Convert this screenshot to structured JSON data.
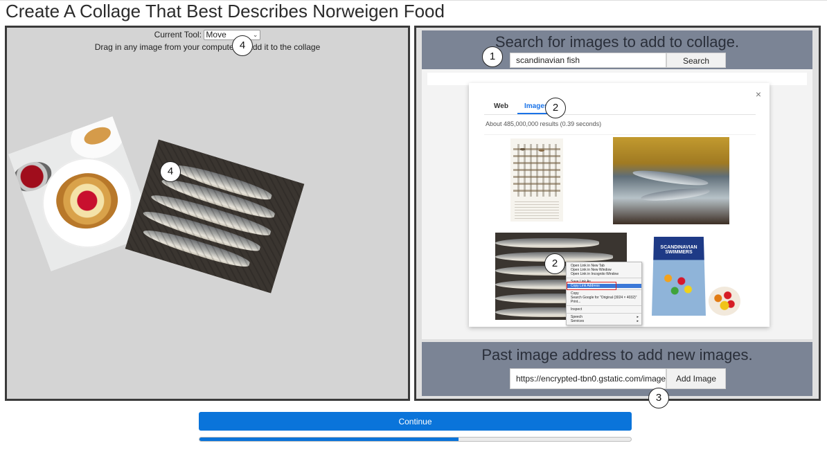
{
  "page": {
    "title": "Create A Collage That Best Describes Norweigen Food",
    "continue_label": "Continue",
    "progress": 0.6
  },
  "collage": {
    "tool_label": "Current Tool:",
    "tool_value": "Move",
    "drag_hint": "Drag in any image from your computer to add it to the collage"
  },
  "search": {
    "title": "Search for images to add to collage.",
    "query": "scandinavian fish",
    "button_label": "Search"
  },
  "results": {
    "close": "×",
    "tabs": [
      "Web",
      "Images"
    ],
    "count_text": "About 485,000,000 results (0.39 seconds)",
    "context_menu": [
      "Open Link in New Tab",
      "Open Link in New Window",
      "Open Link in Incognito Window",
      "Save Link As...",
      "Copy Link Address",
      "Copy",
      "Search Google for \"Original (3024 × 4032)\"",
      "Print...",
      "Inspect",
      "Speech",
      "Services"
    ],
    "candy_label": "SCANDINAVIAN SWIMMERS"
  },
  "paste": {
    "title": "Past image address to add new images.",
    "url_value": "https://encrypted-tbn0.gstatic.com/images?",
    "button_label": "Add Image"
  },
  "markers": {
    "m1": "1",
    "m2": "2",
    "m3": "3",
    "m4": "4"
  }
}
